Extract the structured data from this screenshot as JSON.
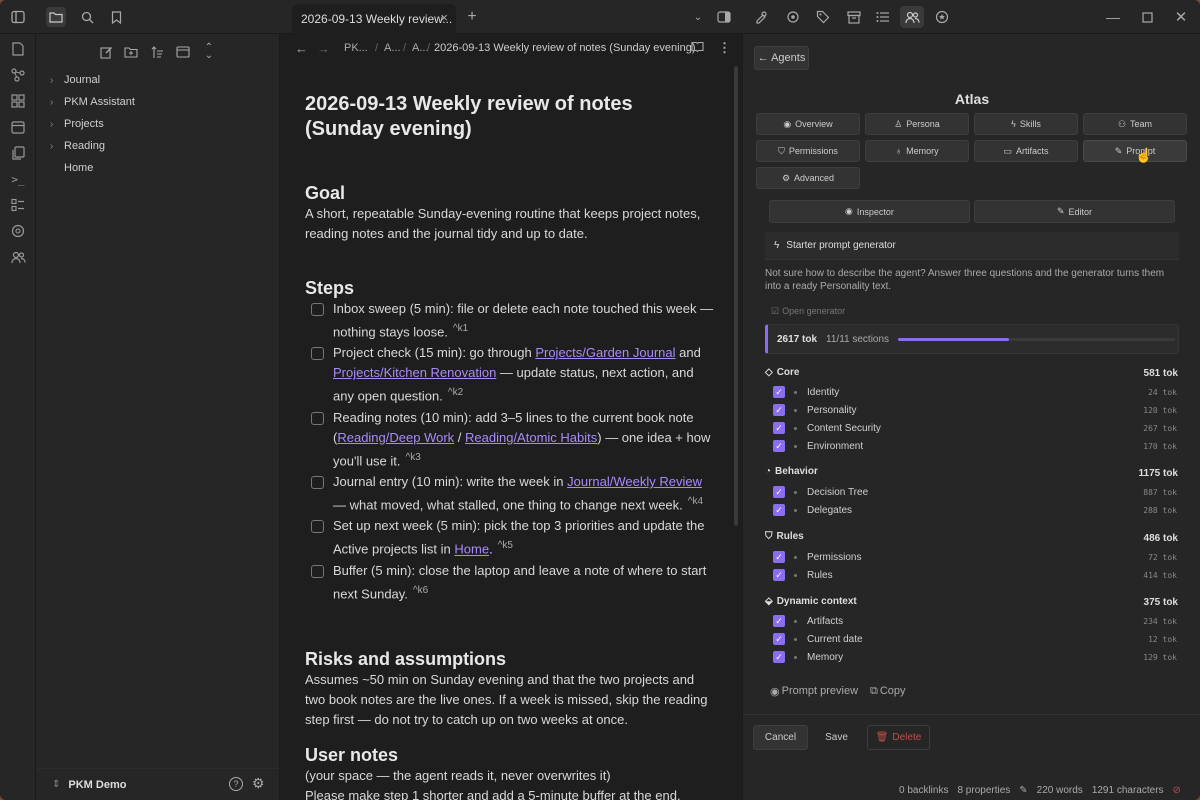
{
  "tab": {
    "title": "2026-09-13 Weekly review...",
    "close": "×",
    "new": "+"
  },
  "sidebar": {
    "items": [
      {
        "label": "Journal",
        "chevron": "›"
      },
      {
        "label": "PKM Assistant",
        "chevron": "›"
      },
      {
        "label": "Projects",
        "chevron": "›"
      },
      {
        "label": "Reading",
        "chevron": "›"
      },
      {
        "label": "Home",
        "chevron": ""
      }
    ],
    "vault": "PKM Demo"
  },
  "editor": {
    "breadcrumb": {
      "seg1": "PK...",
      "seg2": "A...",
      "seg3": "A...",
      "current": "2026-09-13 Weekly review of notes (Sunday evening)"
    },
    "title": "2026-09-13 Weekly review of notes (Sunday evening)",
    "goal_heading": "Goal",
    "goal_text": "A short, repeatable Sunday-evening routine that keeps project notes, reading notes and the journal tidy and up to date.",
    "steps_heading": "Steps",
    "tasks": [
      {
        "pre": "Inbox sweep (5 min): file or delete each note touched this week — nothing stays loose.",
        "ref": "^k1"
      },
      {
        "pre": "Project check (15 min): go through ",
        "link1": "Projects/Garden Journal",
        "mid": " and ",
        "link2": "Projects/Kitchen Renovation",
        "post": " — update status, next action, and any open question.",
        "ref": "^k2"
      },
      {
        "pre": "Reading notes (10 min): add 3–5 lines to the current book note (",
        "link1": "Reading/Deep Work",
        "mid": " / ",
        "link2": "Reading/Atomic Habits",
        "post": ") — one idea + how you'll use it.",
        "ref": "^k3"
      },
      {
        "pre": "Journal entry (10 min): write the week in ",
        "link1": "Journal/Weekly Review",
        "post": " — what moved, what stalled, one thing to change next week.",
        "ref": "^k4"
      },
      {
        "pre": "Set up next week (5 min): pick the top 3 priorities and update the Active projects list in ",
        "link1": "Home",
        "post": ".",
        "ref": "^k5"
      },
      {
        "pre": "Buffer (5 min): close the laptop and leave a note of where to start next Sunday.",
        "ref": "^k6"
      }
    ],
    "risks_heading": "Risks and assumptions",
    "risks_text": "Assumes ~50 min on Sunday evening and that the two projects and two book notes are the live ones. If a week is missed, skip the reading step first — do not try to catch up on two weeks at once.",
    "user_heading": "User notes",
    "user_line1": "(your space — the agent reads it, never overwrites it)",
    "user_line2": "Please make step 1 shorter and add a 5-minute buffer at the end."
  },
  "panel": {
    "back": "← Agents",
    "agent_name": "Atlas",
    "tabs": [
      "Overview",
      "Persona",
      "Skills",
      "Team",
      "Permissions",
      "Memory",
      "Artifacts",
      "Prompt",
      "Advanced"
    ],
    "view_toggle": [
      "Inspector",
      "Editor"
    ],
    "starter_title": "Starter prompt generator",
    "starter_desc": "Not sure how to describe the agent? Answer three questions and the generator turns them into a ready Personality text.",
    "open_generator": "Open generator",
    "tokens_total": "2617 tok",
    "sections_count": "11/11 sections",
    "progress_fraction": 0.4,
    "sections": [
      {
        "name": "Core",
        "tok": "581 tok",
        "items": [
          {
            "label": "Identity",
            "tok": "24 tok"
          },
          {
            "label": "Personality",
            "tok": "120 tok"
          },
          {
            "label": "Content Security",
            "tok": "267 tok"
          },
          {
            "label": "Environment",
            "tok": "170 tok"
          }
        ]
      },
      {
        "name": "Behavior",
        "tok": "1175 tok",
        "items": [
          {
            "label": "Decision Tree",
            "tok": "887 tok"
          },
          {
            "label": "Delegates",
            "tok": "288 tok"
          }
        ]
      },
      {
        "name": "Rules",
        "tok": "486 tok",
        "items": [
          {
            "label": "Permissions",
            "tok": "72 tok"
          },
          {
            "label": "Rules",
            "tok": "414 tok"
          }
        ]
      },
      {
        "name": "Dynamic context",
        "tok": "375 tok",
        "items": [
          {
            "label": "Artifacts",
            "tok": "234 tok"
          },
          {
            "label": "Current date",
            "tok": "12 tok"
          },
          {
            "label": "Memory",
            "tok": "129 tok"
          }
        ]
      }
    ],
    "prompt_preview": "Prompt preview",
    "copy": "Copy",
    "cancel": "Cancel",
    "save": "Save",
    "delete": "Delete"
  },
  "status": {
    "backlinks": "0 backlinks",
    "properties": "8 properties",
    "words": "220 words",
    "characters": "1291 characters"
  },
  "colors": {
    "accent": "#8b6ef0",
    "link": "#a88bfa",
    "background": "#1e1e1e",
    "panel": "#262626"
  }
}
